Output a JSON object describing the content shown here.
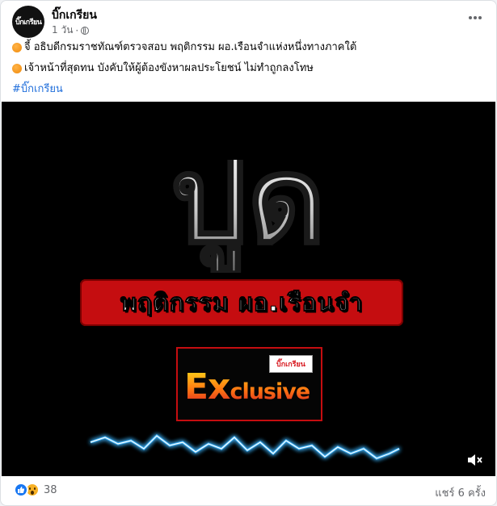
{
  "post": {
    "page_name": "บิ๊กเกรียน",
    "time": "1 วัน",
    "avatar_logo": "บิ๊กเกรียน",
    "lines": [
      "จี้ อธิบดีกรมราชทัณฑ์ตรวจสอบ พฤติกรรม ผอ.เรือนจำแห่งหนึ่งทางภาคใต้",
      "เจ้าหน้าที่สุดทน บังคับให้ผู้ต้องขังหาผลประโยชน์ ไม่ทำถูกลงโทษ"
    ],
    "hashtag": "#บิ๊กเกรียน"
  },
  "media": {
    "headline": "ปูด",
    "banner": "พฤติกรรม ผอ.เรือนจำ",
    "exclusive_big": "Ex",
    "exclusive_small": "clusive",
    "brand_logo": "บิ๊กเกรียน"
  },
  "footer": {
    "reaction_count": "38",
    "shares": "แชร์ 6 ครั้ง"
  },
  "colors": {
    "banner_red": "#c50d10",
    "hashtag_blue": "#216fdb",
    "like_blue": "#1877f2",
    "wave_blue": "#3fb6ff"
  }
}
